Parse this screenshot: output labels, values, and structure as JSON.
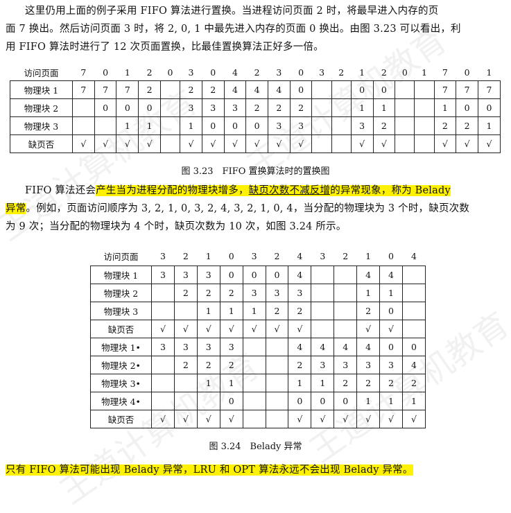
{
  "intro_paragraph": {
    "line1": "这里仍用上面的例子采用 FIFO 算法进行置换。当进程访问页面 2 时，将最早进入内存的页",
    "line2": "面 7 换出。然后访问页面 3 时，将 2, 0, 1 中最先进入内存的页面 0 换出。由图 3.23 可以看出，利",
    "line3": "用 FIFO 算法时进行了 12 次页面置换，比最佳置换算法正好多一倍。"
  },
  "table1": {
    "header_label": "访问页面",
    "pages": [
      "7",
      "0",
      "1",
      "2",
      "0",
      "3",
      "0",
      "4",
      "2",
      "3",
      "0",
      "3",
      "2",
      "1",
      "2",
      "0",
      "1",
      "7",
      "0",
      "1"
    ],
    "rows": [
      {
        "label": "物理块 1",
        "cells": [
          "7",
          "7",
          "7",
          "2",
          "",
          "2",
          "2",
          "4",
          "4",
          "4",
          "0",
          "",
          "",
          "0",
          "0",
          "",
          "",
          "7",
          "7",
          "7"
        ]
      },
      {
        "label": "物理块 2",
        "cells": [
          "",
          "0",
          "0",
          "0",
          "",
          "3",
          "3",
          "3",
          "2",
          "2",
          "2",
          "",
          "",
          "1",
          "1",
          "",
          "",
          "1",
          "0",
          "0"
        ]
      },
      {
        "label": "物理块 3",
        "cells": [
          "",
          "",
          "1",
          "1",
          "",
          "1",
          "0",
          "0",
          "0",
          "3",
          "3",
          "",
          "",
          "3",
          "2",
          "",
          "",
          "2",
          "2",
          "1"
        ]
      },
      {
        "label": "缺页否",
        "cells": [
          "√",
          "√",
          "√",
          "√",
          "",
          "√",
          "√",
          "√",
          "√",
          "√",
          "√",
          "",
          "",
          "√",
          "√",
          "",
          "",
          "√",
          "√",
          "√"
        ]
      }
    ],
    "caption": "图 3.23　FIFO 置换算法时的置换图"
  },
  "belady_paragraph": {
    "p1": "FIFO 算法还会",
    "h1": "产生当为进程分配的物理块增多，",
    "h2": "缺页次数不减反增",
    "h3": "的异常现象，称为 Belady",
    "h4": "异常",
    "p2": "。例如，页面访问顺序为 3, 2, 1, 0, 3, 2, 4, 3, 2, 1, 0, 4，当分配的物理块为 3 个时，缺页次数",
    "line3": "为 9 次；当分配的物理块为 4 个时，缺页次数为 10 次，如图 3.24 所示。"
  },
  "table2": {
    "header_label": "访问页面",
    "pages": [
      "3",
      "2",
      "1",
      "0",
      "3",
      "2",
      "4",
      "3",
      "2",
      "1",
      "0",
      "4"
    ],
    "rows": [
      {
        "label": "物理块 1",
        "cells": [
          "3",
          "3",
          "3",
          "0",
          "0",
          "0",
          "4",
          "",
          "",
          "4",
          "4",
          ""
        ]
      },
      {
        "label": "物理块 2",
        "cells": [
          "",
          "2",
          "2",
          "2",
          "3",
          "3",
          "3",
          "",
          "",
          "1",
          "1",
          ""
        ]
      },
      {
        "label": "物理块 3",
        "cells": [
          "",
          "",
          "1",
          "1",
          "1",
          "2",
          "2",
          "",
          "",
          "2",
          "0",
          ""
        ]
      },
      {
        "label": "缺页否",
        "cells": [
          "√",
          "√",
          "√",
          "√",
          "√",
          "√",
          "√",
          "",
          "",
          "√",
          "√",
          ""
        ]
      },
      {
        "label": "物理块 1•",
        "cells": [
          "3",
          "3",
          "3",
          "3",
          "",
          "",
          "4",
          "4",
          "4",
          "4",
          "0",
          "0"
        ]
      },
      {
        "label": "物理块 2•",
        "cells": [
          "",
          "2",
          "2",
          "2",
          "",
          "",
          "2",
          "3",
          "3",
          "3",
          "3",
          "4"
        ]
      },
      {
        "label": "物理块 3•",
        "cells": [
          "",
          "",
          "1",
          "1",
          "",
          "",
          "1",
          "1",
          "2",
          "2",
          "2",
          "2"
        ]
      },
      {
        "label": "物理块 4•",
        "cells": [
          "",
          "",
          "",
          "0",
          "",
          "",
          "0",
          "0",
          "0",
          "1",
          "1",
          "1"
        ]
      },
      {
        "label": "缺页否",
        "cells": [
          "√",
          "√",
          "√",
          "√",
          "",
          "",
          "√",
          "√",
          "√",
          "√",
          "√",
          "√"
        ]
      }
    ],
    "caption": "图 3.24　Belady 异常"
  },
  "conclusion": "只有 FIFO 算法可能出现 Belady 异常，LRU 和 OPT 算法永远不会出现 Belady 异常。",
  "colors": {
    "highlight": "#fff200",
    "border": "#222222"
  }
}
